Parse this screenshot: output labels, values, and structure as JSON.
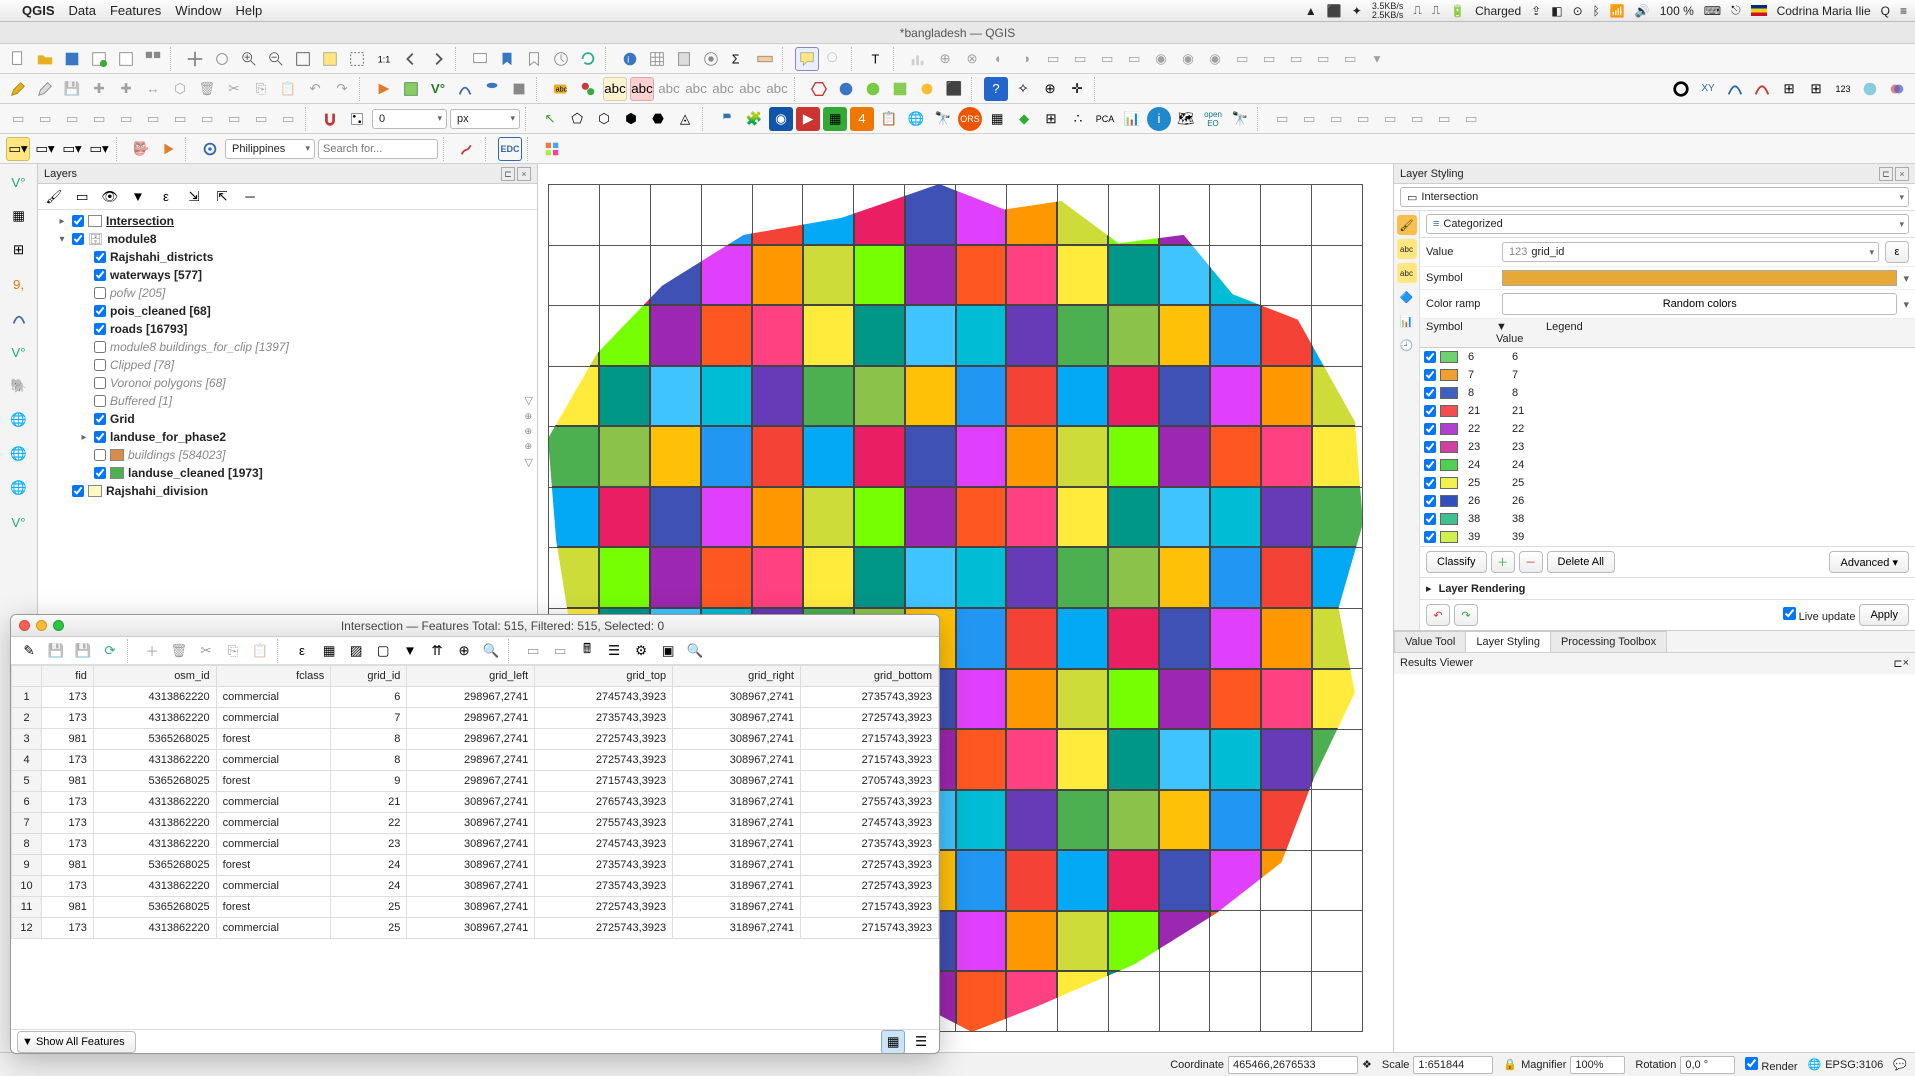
{
  "mac_menu": {
    "items": [
      "QGIS",
      "Data",
      "Features",
      "Window",
      "Help"
    ],
    "net_up": "3.5KB/s",
    "net_down": "2.5KB/s",
    "battery": "Charged",
    "percent": "100 %",
    "user": "Codrina Maria Ilie"
  },
  "window_title": "*bangladesh — QGIS",
  "toolbar3": {
    "spin_value": "0",
    "unit": "px"
  },
  "toolbar4": {
    "region": "Philippines",
    "search_placeholder": "Search for..."
  },
  "layers_panel": {
    "title": "Layers",
    "tree": [
      {
        "indent": 1,
        "exp": "▸",
        "checked": true,
        "swatch": "#ffffff",
        "name": "Intersection",
        "style": "underline"
      },
      {
        "indent": 1,
        "exp": "▾",
        "checked": true,
        "swatch": "",
        "name": "module8",
        "style": "bold",
        "icon": "db"
      },
      {
        "indent": 2,
        "exp": "",
        "checked": true,
        "swatch": "",
        "name": "Rajshahi_districts",
        "style": "bold"
      },
      {
        "indent": 2,
        "exp": "",
        "checked": true,
        "swatch": "",
        "name": "waterways [577]",
        "style": "bold"
      },
      {
        "indent": 2,
        "exp": "",
        "checked": false,
        "swatch": "",
        "name": "pofw [205]",
        "style": "grey"
      },
      {
        "indent": 2,
        "exp": "",
        "checked": true,
        "swatch": "",
        "name": "pois_cleaned [68]",
        "style": "bold"
      },
      {
        "indent": 2,
        "exp": "",
        "checked": true,
        "swatch": "",
        "name": "roads [16793]",
        "style": "bold"
      },
      {
        "indent": 2,
        "exp": "",
        "checked": false,
        "swatch": "",
        "name": "module8 buildings_for_clip [1397]",
        "style": "grey"
      },
      {
        "indent": 2,
        "exp": "",
        "checked": false,
        "swatch": "",
        "name": "Clipped [78]",
        "style": "grey"
      },
      {
        "indent": 2,
        "exp": "",
        "checked": false,
        "swatch": "",
        "name": "Voronoi polygons [68]",
        "style": "grey"
      },
      {
        "indent": 2,
        "exp": "",
        "checked": false,
        "swatch": "",
        "name": "Buffered [1]",
        "style": "grey"
      },
      {
        "indent": 2,
        "exp": "",
        "checked": true,
        "swatch": "",
        "name": "Grid",
        "style": "bold"
      },
      {
        "indent": 2,
        "exp": "▸",
        "checked": true,
        "swatch": "",
        "name": "landuse_for_phase2",
        "style": "bold"
      },
      {
        "indent": 2,
        "exp": "",
        "checked": false,
        "swatch": "#d98b4a",
        "name": "buildings [584023]",
        "style": "grey"
      },
      {
        "indent": 2,
        "exp": "",
        "checked": true,
        "swatch": "#4caf50",
        "name": "landuse_cleaned [1973]",
        "style": "bold"
      },
      {
        "indent": 1,
        "exp": "",
        "checked": true,
        "swatch": "#fff8c0",
        "name": "Rajshahi_division",
        "style": "bold"
      }
    ]
  },
  "styling": {
    "title": "Layer Styling",
    "layer_combo": "Intersection",
    "renderer": "Categorized",
    "value_label": "Value",
    "value_field": "grid_id",
    "value_prefix": "123",
    "symbol_label": "Symbol",
    "ramp_label": "Color ramp",
    "ramp_value": "Random colors",
    "columns": {
      "symbol": "Symbol",
      "value": "Value",
      "legend": "Legend"
    },
    "rows": [
      {
        "c": "#6fd06f",
        "v": "6",
        "l": "6"
      },
      {
        "c": "#f0a030",
        "v": "7",
        "l": "7"
      },
      {
        "c": "#4060c0",
        "v": "8",
        "l": "8"
      },
      {
        "c": "#f05050",
        "v": "21",
        "l": "21"
      },
      {
        "c": "#b040d0",
        "v": "22",
        "l": "22"
      },
      {
        "c": "#d040a0",
        "v": "23",
        "l": "23"
      },
      {
        "c": "#50d050",
        "v": "24",
        "l": "24"
      },
      {
        "c": "#f0f050",
        "v": "25",
        "l": "25"
      },
      {
        "c": "#3050c0",
        "v": "26",
        "l": "26"
      },
      {
        "c": "#40c090",
        "v": "38",
        "l": "38"
      },
      {
        "c": "#d0f050",
        "v": "39",
        "l": "39"
      }
    ],
    "classify": "Classify",
    "delete_all": "Delete All",
    "advanced": "Advanced",
    "layer_rendering": "Layer Rendering",
    "live_update": "Live update",
    "apply": "Apply",
    "tabs": [
      "Value Tool",
      "Layer Styling",
      "Processing Toolbox"
    ],
    "results": "Results Viewer"
  },
  "attr": {
    "title": "Intersection — Features Total: 515, Filtered: 515, Selected: 0",
    "columns": [
      "",
      "fid",
      "osm_id",
      "fclass",
      "grid_id",
      "grid_left",
      "grid_top",
      "grid_right",
      "grid_bottom"
    ],
    "rows": [
      [
        "1",
        "173",
        "4313862220",
        "commercial",
        "6",
        "298967,2741",
        "2745743,3923",
        "308967,2741",
        "2735743,3923"
      ],
      [
        "2",
        "173",
        "4313862220",
        "commercial",
        "7",
        "298967,2741",
        "2735743,3923",
        "308967,2741",
        "2725743,3923"
      ],
      [
        "3",
        "981",
        "5365268025",
        "forest",
        "8",
        "298967,2741",
        "2725743,3923",
        "308967,2741",
        "2715743,3923"
      ],
      [
        "4",
        "173",
        "4313862220",
        "commercial",
        "8",
        "298967,2741",
        "2725743,3923",
        "308967,2741",
        "2715743,3923"
      ],
      [
        "5",
        "981",
        "5365268025",
        "forest",
        "9",
        "298967,2741",
        "2715743,3923",
        "308967,2741",
        "2705743,3923"
      ],
      [
        "6",
        "173",
        "4313862220",
        "commercial",
        "21",
        "308967,2741",
        "2765743,3923",
        "318967,2741",
        "2755743,3923"
      ],
      [
        "7",
        "173",
        "4313862220",
        "commercial",
        "22",
        "308967,2741",
        "2755743,3923",
        "318967,2741",
        "2745743,3923"
      ],
      [
        "8",
        "173",
        "4313862220",
        "commercial",
        "23",
        "308967,2741",
        "2745743,3923",
        "318967,2741",
        "2735743,3923"
      ],
      [
        "9",
        "981",
        "5365268025",
        "forest",
        "24",
        "308967,2741",
        "2735743,3923",
        "318967,2741",
        "2725743,3923"
      ],
      [
        "10",
        "173",
        "4313862220",
        "commercial",
        "24",
        "308967,2741",
        "2735743,3923",
        "318967,2741",
        "2725743,3923"
      ],
      [
        "11",
        "981",
        "5365268025",
        "forest",
        "25",
        "308967,2741",
        "2725743,3923",
        "318967,2741",
        "2715743,3923"
      ],
      [
        "12",
        "173",
        "4313862220",
        "commercial",
        "25",
        "308967,2741",
        "2725743,3923",
        "318967,2741",
        "2715743,3923"
      ]
    ],
    "footer": "Show All Features"
  },
  "status": {
    "coord_label": "Coordinate",
    "coord": "465466,2676533",
    "scale_label": "Scale",
    "scale": "1:651844",
    "mag_label": "Magnifier",
    "mag": "100%",
    "rot_label": "Rotation",
    "rot": "0,0 °",
    "render": "Render",
    "crs": "EPSG:3106"
  },
  "map_colors": [
    "#4caf50",
    "#2196f3",
    "#e91e63",
    "#ff9800",
    "#9c27b0",
    "#ffeb3b",
    "#00bcd4",
    "#8bc34a",
    "#f44336",
    "#3f51b5",
    "#cddc39",
    "#ff5722",
    "#009688",
    "#673ab7",
    "#ffc107",
    "#03a9f4",
    "#e040fb",
    "#76ff03",
    "#ff4081",
    "#40c4ff"
  ]
}
